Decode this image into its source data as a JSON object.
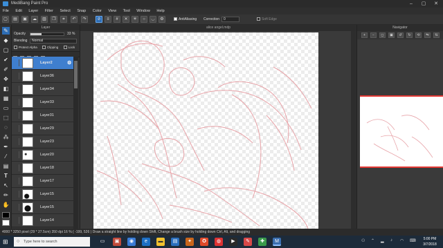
{
  "window": {
    "title": "MediBang Paint Pro",
    "minimize": "–",
    "maximize": "▢",
    "close": "✕"
  },
  "menu": [
    "File",
    "Edit",
    "Layer",
    "Filter",
    "Select",
    "Snap",
    "Color",
    "View",
    "Tool",
    "Window",
    "Help"
  ],
  "toolbar": {
    "antialiasing_label": "AntiAliasing",
    "correction_label": "Correction",
    "correction_value": "0",
    "soft_edge_label": "Soft Edge",
    "antialiasing_checked": true,
    "soft_edge_checked": false
  },
  "layer_panel": {
    "title": "Layer",
    "opacity_label": "Opacity",
    "opacity_value": "33 %",
    "opacity_level": 0.33,
    "blending_label": "Blending",
    "blending_value": "Normal",
    "protect_alpha_label": "Protect Alpha",
    "clipping_label": "Clipping",
    "lock_label": "Lock",
    "gear_icon": "⚙",
    "layers": [
      {
        "name": "Layer2",
        "selected": true
      },
      {
        "name": "Layer36"
      },
      {
        "name": "Layer34"
      },
      {
        "name": "Layer33"
      },
      {
        "name": "Layer31"
      },
      {
        "name": "Layer29"
      },
      {
        "name": "Layer23"
      },
      {
        "name": "Layer20"
      },
      {
        "name": "Layer18"
      },
      {
        "name": "Layer17"
      },
      {
        "name": "Layer15"
      },
      {
        "name": "Layer15"
      },
      {
        "name": "Layer14"
      }
    ]
  },
  "canvas": {
    "tab_title": "alice angel.mdp",
    "sketch_color": "#e8a3a8"
  },
  "navigator": {
    "title": "Navigator",
    "frame_color": "#e53935"
  },
  "status": {
    "size": "4000 * 3250 pixel",
    "physical": "(29 * 27.5cm)",
    "dpi": "350 dpi",
    "zoom": "16 %",
    "coords": "( -199, 526 )",
    "hint": "Draw a straight line by holding down Shift, Change a brush size by holding down Ctrl, Alt, and dragging"
  },
  "taskbar": {
    "search_placeholder": "Type here to search",
    "time": "5:00 PM",
    "date": "3/7/2018",
    "accent": "#1d2b3a"
  },
  "colors": {
    "accent": "#3f7fcf",
    "panel": "#333333",
    "primary_color": "#000000",
    "secondary_color": "#ffffff"
  }
}
